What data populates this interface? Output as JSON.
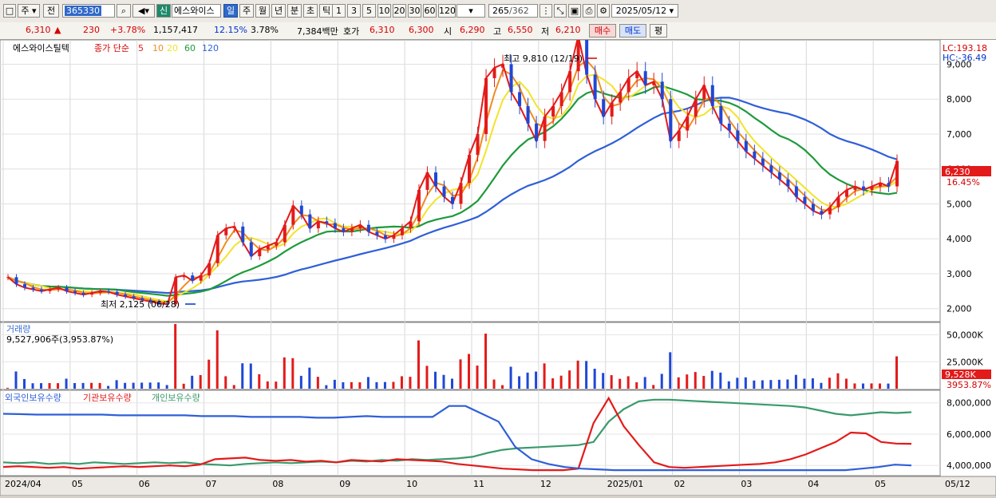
{
  "toolbar": {
    "menu_glyph": "□",
    "market": "주",
    "prev": "전",
    "code": "365330",
    "new_badge": "신",
    "name": "에스와이스",
    "periods": [
      "일",
      "주",
      "월",
      "년",
      "분",
      "초",
      "틱"
    ],
    "period_selected": "일",
    "minutes": [
      "1",
      "3",
      "5",
      "10",
      "20",
      "30",
      "60",
      "120"
    ],
    "count": "265",
    "total": "/362",
    "date": "2025/05/12"
  },
  "quote": {
    "price": "6,310",
    "change": "230",
    "change_pct": "+3.78%",
    "volume": "1,157,417",
    "turnover": "12.15%",
    "rate": "3.78%",
    "amount": "7,384백만",
    "label_bid": "호가",
    "bid": "6,310",
    "ask": "6,300",
    "label_open": "시",
    "open": "6,290",
    "label_high": "고",
    "high": "6,550",
    "label_low": "저",
    "low": "6,210",
    "buy": "매수",
    "sell": "매도",
    "eval": "평"
  },
  "chart_data": {
    "type": "line",
    "stock_name": "에스와이스틸텍",
    "indicator_label": "종가 단순",
    "ma_periods": [
      "5",
      "10",
      "20",
      "60",
      "120"
    ],
    "colors": {
      "candle_up": "#e31a1a",
      "candle_down": "#1f47d6",
      "ma5": "#e31a1a",
      "ma10": "#f08c1e",
      "ma20": "#f2e32a",
      "ma60": "#1e9a3b",
      "ma120": "#2f5fd8",
      "ind_foreign": "#2f5fd8",
      "ind_inst": "#e31a1a",
      "ind_indiv": "#3a9a6c"
    },
    "price_axis": {
      "ticks": [
        "9,000",
        "8,000",
        "7,000",
        "6,000",
        "5,000",
        "4,000",
        "3,000",
        "2,000"
      ],
      "min": 1650,
      "max": 9650
    },
    "lc": "LC:193.18",
    "hc": "HC:-36.49",
    "high_label": "최고 9,810 (12/19)",
    "low_label": "최저 2,125 (06/28)",
    "last_price": "6,230",
    "last_pct": "16.45%",
    "x_labels": [
      "2024/04",
      "05",
      "06",
      "07",
      "08",
      "09",
      "10",
      "11",
      "12",
      "2025/01",
      "02",
      "03",
      "04",
      "05"
    ],
    "x_right": "05/12",
    "close_series": [
      2900,
      2700,
      2600,
      2550,
      2500,
      2550,
      2600,
      2500,
      2450,
      2400,
      2450,
      2500,
      2480,
      2400,
      2350,
      2300,
      2250,
      2200,
      2150,
      2125,
      2900,
      2950,
      2800,
      2950,
      3300,
      4100,
      4300,
      4350,
      3900,
      3500,
      3700,
      3800,
      3900,
      4400,
      4950,
      4700,
      4300,
      4500,
      4450,
      4300,
      4200,
      4300,
      4400,
      4200,
      4100,
      4000,
      4100,
      4300,
      4500,
      5400,
      5900,
      5500,
      5200,
      5000,
      5600,
      6400,
      7000,
      8600,
      8900,
      9000,
      8200,
      7800,
      7300,
      6800,
      7500,
      7800,
      8200,
      8800,
      9810,
      8700,
      8000,
      7500,
      7900,
      8200,
      8600,
      8800,
      8400,
      8500,
      8000,
      6800,
      7100,
      7500,
      8000,
      8400,
      7800,
      7300,
      7100,
      6800,
      6500,
      6300,
      6100,
      5900,
      5700,
      5500,
      5200,
      5000,
      4800,
      4700,
      4900,
      5200,
      5400,
      5500,
      5400,
      5500,
      5600,
      5500,
      6230
    ],
    "volume": {
      "label": "거래량",
      "value_text": "9,527,906주(3,953.87%)",
      "ticks": [
        "50,000K",
        "25,000K"
      ],
      "max": 60000,
      "last_label": "9,528K",
      "last_pct": "3953.87%"
    },
    "ownership": {
      "labels": [
        "외국인보유수량",
        "기관보유수량",
        "개인보유수량"
      ],
      "ticks": [
        "8,000,000",
        "6,000,000",
        "4,000,000"
      ],
      "min": 3400000,
      "max": 8700000
    },
    "foreign_series": [
      7300000,
      7280000,
      7250000,
      7250000,
      7250000,
      7250000,
      7250000,
      7200000,
      7200000,
      7200000,
      7200000,
      7200000,
      7150000,
      7150000,
      7150000,
      7100000,
      7100000,
      7100000,
      7100000,
      7050000,
      7050000,
      7100000,
      7150000,
      7100000,
      7100000,
      7100000,
      7100000,
      7800000,
      7800000,
      7300000,
      6800000,
      5200000,
      4400000,
      4100000,
      3900000,
      3800000,
      3750000,
      3700000,
      3700000,
      3700000,
      3700000,
      3700000,
      3700000,
      3700000,
      3700000,
      3700000,
      3700000,
      3700000,
      3700000,
      3700000,
      3700000,
      3700000,
      3800000,
      3900000,
      4050000,
      4000000
    ],
    "inst_series": [
      3900000,
      3950000,
      3900000,
      3850000,
      3900000,
      3800000,
      3850000,
      3900000,
      3950000,
      3900000,
      3950000,
      4000000,
      3950000,
      4050000,
      4400000,
      4450000,
      4500000,
      4350000,
      4300000,
      4350000,
      4250000,
      4300000,
      4200000,
      4350000,
      4300000,
      4250000,
      4400000,
      4350000,
      4300000,
      4250000,
      4100000,
      4000000,
      3900000,
      3800000,
      3750000,
      3700000,
      3700000,
      3700000,
      3800000,
      6700000,
      8300000,
      6500000,
      5300000,
      4200000,
      3900000,
      3850000,
      3900000,
      3950000,
      4000000,
      4050000,
      4100000,
      4200000,
      4400000,
      4700000,
      5100000,
      5500000,
      6100000,
      6050000,
      5500000,
      5400000,
      5380000
    ],
    "indiv_series": [
      4200000,
      4150000,
      4200000,
      4100000,
      4150000,
      4100000,
      4200000,
      4150000,
      4100000,
      4150000,
      4200000,
      4150000,
      4200000,
      4100000,
      4050000,
      4000000,
      4100000,
      4150000,
      4200000,
      4150000,
      4200000,
      4250000,
      4200000,
      4300000,
      4250000,
      4350000,
      4300000,
      4400000,
      4350000,
      4400000,
      4450000,
      4550000,
      4800000,
      5000000,
      5100000,
      5150000,
      5200000,
      5250000,
      5300000,
      5500000,
      6800000,
      7600000,
      8100000,
      8200000,
      8200000,
      8150000,
      8100000,
      8050000,
      8000000,
      7950000,
      7900000,
      7850000,
      7800000,
      7700000,
      7500000,
      7300000,
      7200000,
      7300000,
      7400000,
      7350000,
      7400000
    ]
  }
}
